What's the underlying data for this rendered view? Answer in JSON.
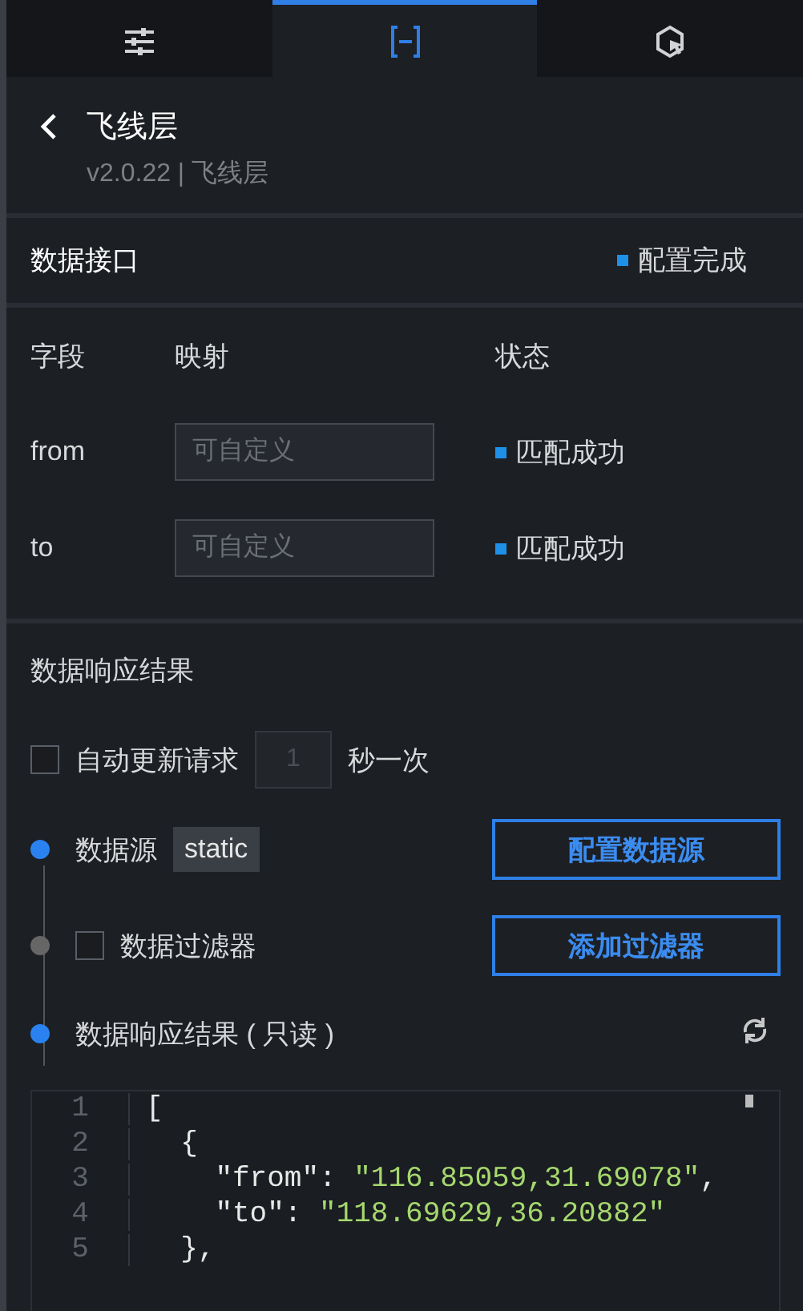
{
  "tabs": [
    {
      "kind": "sliders",
      "selected": false
    },
    {
      "kind": "brackets",
      "selected": true
    },
    {
      "kind": "cursor",
      "selected": false
    }
  ],
  "header": {
    "title": "飞线层",
    "subtitle": "v2.0.22 | 飞线层"
  },
  "data_interface": {
    "title": "数据接口",
    "status": "配置完成"
  },
  "mapping": {
    "columns": [
      "字段",
      "映射",
      "状态"
    ],
    "rows": [
      {
        "field": "from",
        "placeholder": "可自定义",
        "status": "匹配成功"
      },
      {
        "field": "to",
        "placeholder": "可自定义",
        "status": "匹配成功"
      }
    ]
  },
  "response_title": "数据响应结果",
  "auto_update": {
    "label": "自动更新请求",
    "checked": false,
    "interval": "1",
    "unit": "秒一次"
  },
  "pipeline": [
    {
      "kind": "source",
      "active": true,
      "label": "数据源",
      "tag": "static",
      "button": "配置数据源"
    },
    {
      "kind": "filter",
      "active": false,
      "checked": false,
      "label": "数据过滤器",
      "button": "添加过滤器"
    },
    {
      "kind": "result",
      "active": true,
      "label": "数据响应结果 ( 只读 )"
    }
  ],
  "code": [
    {
      "number": "1",
      "tokens": [
        {
          "kind": "punct",
          "text": "["
        }
      ]
    },
    {
      "number": "2",
      "tokens": [
        {
          "kind": "punct",
          "text": "  {"
        }
      ]
    },
    {
      "number": "3",
      "tokens": [
        {
          "kind": "punct",
          "text": "    \"from\": "
        },
        {
          "kind": "string",
          "text": "\"116.85059,31.69078\""
        },
        {
          "kind": "punct",
          "text": ","
        }
      ]
    },
    {
      "number": "4",
      "tokens": [
        {
          "kind": "punct",
          "text": "    \"to\": "
        },
        {
          "kind": "string",
          "text": "\"118.69629,36.20882\""
        }
      ]
    },
    {
      "number": "5",
      "tokens": [
        {
          "kind": "punct",
          "text": "  },"
        }
      ]
    }
  ]
}
